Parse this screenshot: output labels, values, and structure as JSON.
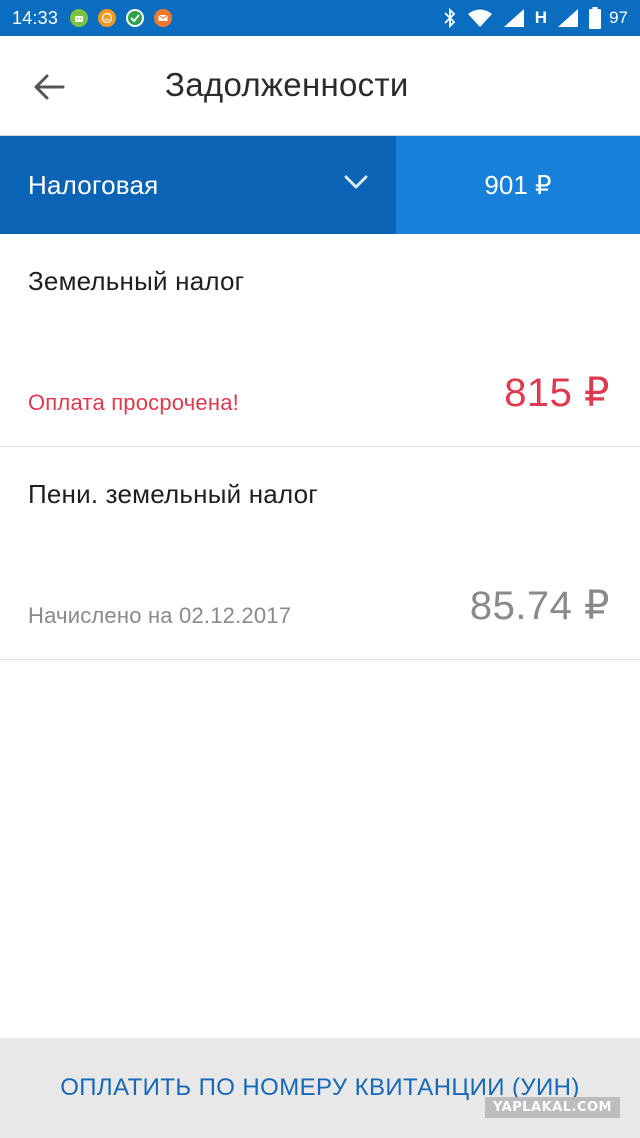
{
  "status_bar": {
    "time": "14:33",
    "network_letter": "H",
    "battery": "97",
    "notification_icons": [
      {
        "icon": "android-green-icon",
        "color": "#7cc242"
      },
      {
        "icon": "smile-orange-icon",
        "color": "#f39a1e"
      },
      {
        "icon": "sberbank-icon",
        "color": "#2ea34a"
      },
      {
        "icon": "mail-orange-icon",
        "color": "#f07a2a"
      }
    ]
  },
  "app_bar": {
    "title": "Задолженности",
    "back_icon": "arrow-left-icon"
  },
  "filter": {
    "selected": "Налоговая",
    "total": "901 ₽",
    "select_color": "#0b63b5",
    "total_color": "#1780d8"
  },
  "debts": [
    {
      "title": "Земельный налог",
      "status": "Оплата просрочена!",
      "amount": "815 ₽",
      "status_color": "#e0384f",
      "amount_color": "#e0384f"
    },
    {
      "title": "Пени. земельный налог",
      "status": "Начислено на 02.12.2017",
      "amount": "85.74 ₽",
      "status_color": "#8a8a8a",
      "amount_color": "#8a8a8a"
    }
  ],
  "bottom_action": {
    "label": "ОПЛАТИТЬ ПО НОМЕРУ КВИТАНЦИИ (УИН)",
    "color": "#1668b8"
  },
  "watermark": "YAPLAKAL.COM"
}
